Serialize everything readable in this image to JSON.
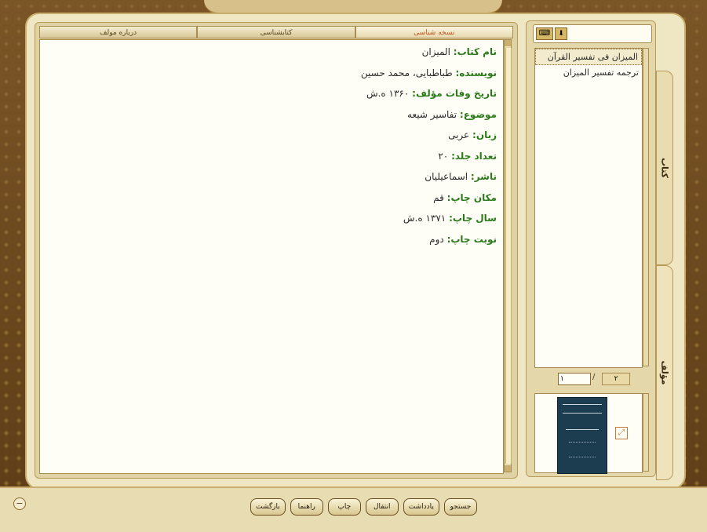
{
  "tabs": [
    {
      "label": "نسخه شناسی",
      "active": true
    },
    {
      "label": "کتابشناسی",
      "active": false
    },
    {
      "label": "درباره مولف",
      "active": false
    }
  ],
  "book_info": [
    {
      "label": "نام کتاب:",
      "value": "المیزان"
    },
    {
      "label": "نویسنده:",
      "value": "طباطبایی، محمد حسین"
    },
    {
      "label": "تاریخ وفات مؤلف:",
      "value": "۱۳۶۰ ه.ش"
    },
    {
      "label": "موضوع:",
      "value": "تفاسیر شیعه"
    },
    {
      "label": "زبان:",
      "value": "عربی"
    },
    {
      "label": "تعداد جلد:",
      "value": "۲۰"
    },
    {
      "label": "ناشر:",
      "value": "اسماعیلیان"
    },
    {
      "label": "مکان چاپ:",
      "value": "قم"
    },
    {
      "label": "سال چاپ:",
      "value": "۱۳۷۱ ه.ش"
    },
    {
      "label": "نوبت چاپ:",
      "value": "دوم"
    }
  ],
  "book_list": [
    {
      "title": "المیزان فی تفسیر القرآن",
      "selected": true
    },
    {
      "title": "ترجمه تفسیر المیزان",
      "selected": false
    }
  ],
  "pager": {
    "current": "۱",
    "separator": "/",
    "total": "۲"
  },
  "side_tabs": {
    "book": "کتاب",
    "author": "مؤلف"
  },
  "bottom_buttons": [
    "جستجو",
    "یادداشت",
    "انتقال",
    "چاپ",
    "راهنما",
    "بازگشت"
  ],
  "icons": {
    "keyboard": "keyboard-icon",
    "download": "download-arrow-icon",
    "expand": "expand-icon",
    "minimize": "minimize-icon"
  },
  "colors": {
    "label_green": "#2a7a1a",
    "active_tab": "#c0501a",
    "cover_blue": "#1b3d4f"
  }
}
